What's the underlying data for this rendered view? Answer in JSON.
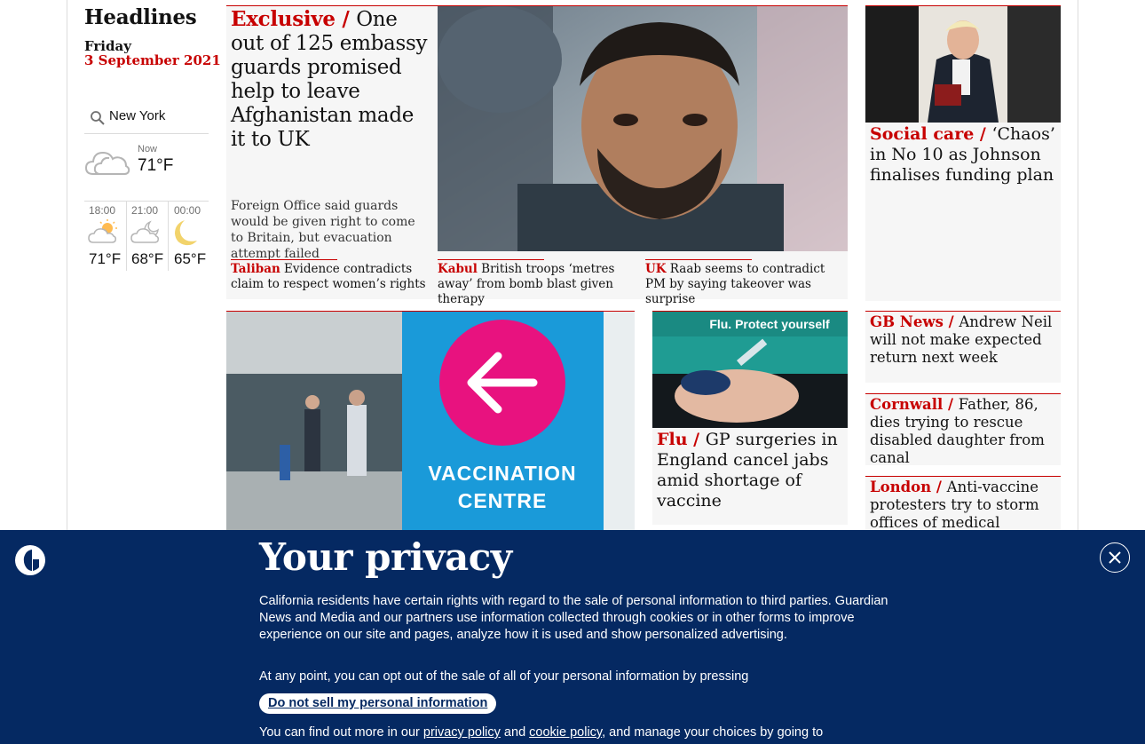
{
  "sidebar": {
    "title": "Headlines",
    "day": "Friday",
    "date": "3 September 2021",
    "weather": {
      "location": "New York",
      "now_label": "Now",
      "now_temp": "71°F",
      "now_icon": "cloudy-icon",
      "forecast": [
        {
          "time": "18:00",
          "temp": "71°F",
          "icon": "partly-sunny-icon"
        },
        {
          "time": "21:00",
          "temp": "68°F",
          "icon": "cloudy-moon-icon"
        },
        {
          "time": "00:00",
          "temp": "65°F",
          "icon": "moon-icon"
        }
      ]
    }
  },
  "main_story": {
    "kicker": "Exclusive / ",
    "headline": "One out of 125 embassy guards promised help to leave Afghanistan made it to UK",
    "trail": "Foreign Office said guards would be given right to come to Britain, but evacuation attempt failed",
    "sublinks": [
      {
        "kicker": "Taliban",
        "text": " Evidence contradicts claim to respect women’s rights"
      },
      {
        "kicker": "Kabul",
        "text": " British troops ‘metres away’ from bomb blast given therapy"
      },
      {
        "kicker": "UK",
        "text": " Raab seems to contradict PM by saying takeover was surprise"
      }
    ]
  },
  "right_column": {
    "lead": {
      "kicker": "Social care / ",
      "headline": "‘Chaos’ in No 10 as Johnson finalises funding plan"
    },
    "items": [
      {
        "kicker": "GB News / ",
        "headline": "Andrew Neil will not make expected return next week"
      },
      {
        "kicker": "Cornwall / ",
        "headline": "Father, 86, dies trying to rescue disabled daughter from canal"
      },
      {
        "kicker": "London / ",
        "headline": "Anti-vaccine protesters try to storm offices of medical regulator"
      }
    ]
  },
  "second_row": {
    "vaccination_sign": "VACCINATION CENTRE",
    "flu": {
      "kicker": "Flu / ",
      "headline": "GP surgeries in England cancel jabs amid shortage of vaccine",
      "image_text": "Flu. Protect yourself"
    }
  },
  "privacy": {
    "title": "Your privacy",
    "para1": "California residents have certain rights with regard to the sale of personal information to third parties. Guardian News and Media and our partners use information collected through cookies or in other forms to improve experience on our site and pages, analyze how it is used and show personalized advertising.",
    "para2": "At any point, you can opt out of the sale of all of your personal information by pressing",
    "button": "Do not sell my personal information",
    "para3_start": "You can find out more in our ",
    "privacy_link": "privacy policy",
    "and": " and ",
    "cookie_link": "cookie policy",
    "para3_end": ", and manage your choices by going to"
  }
}
